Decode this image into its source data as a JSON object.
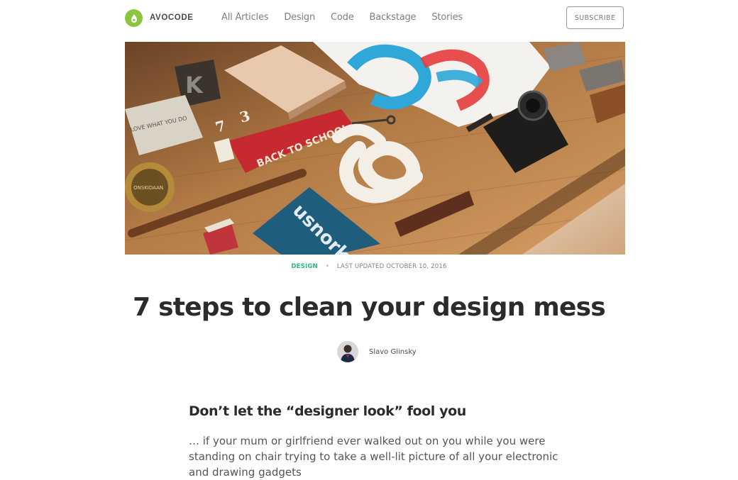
{
  "header": {
    "brand": "AVOCODE",
    "nav": [
      "All Articles",
      "Design",
      "Code",
      "Backstage",
      "Stories"
    ],
    "subscribe_label": "SUBSCRIBE"
  },
  "article": {
    "category": "DESIGN",
    "updated": "LAST UPDATED OCTOBER 10, 2016",
    "title": "7 steps to clean your design mess",
    "author": "Slavo Glinsky",
    "section_heading": "Don’t let the “designer look” fool you",
    "paragraph": "… if your mum or girlfriend ever walked out on you while you were standing on chair trying to take a well-lit picture of all your electronic and drawing gadgets"
  },
  "hero": {
    "pennant_text": "BACK TO SCHOOL",
    "book_text": "LOVE WHAT YOU DO",
    "box_text": "usnork",
    "stamp_text": "ONSKIDAAN"
  },
  "colors": {
    "brand_green": "#8cc63f",
    "category_green": "#34b47a",
    "wood": "#a8713f"
  }
}
